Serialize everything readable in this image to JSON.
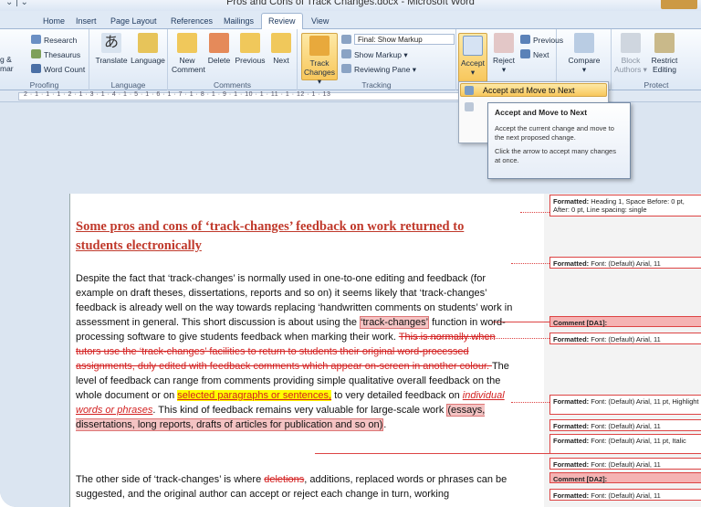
{
  "window": {
    "title": "Pros and Cons of Track Changes.docx - Microsoft Word"
  },
  "tabs": [
    "Home",
    "Insert",
    "Page Layout",
    "References",
    "Mailings",
    "Review",
    "View"
  ],
  "ribbon": {
    "proofing": {
      "label": "Proofing",
      "research": "Research",
      "thesaurus": "Thesaurus",
      "word_count": "Word Count",
      "spelling_top": "g &",
      "spelling_bottom": "mar"
    },
    "language": {
      "label": "Language",
      "translate": "Translate",
      "language": "Language"
    },
    "comments": {
      "label": "Comments",
      "new": "New",
      "new2": "Comment",
      "delete": "Delete",
      "previous": "Previous",
      "next": "Next"
    },
    "tracking": {
      "label": "Tracking",
      "track": "Track",
      "track2": "Changes ▾",
      "final_markup": "Final: Show Markup",
      "show_markup": "Show Markup ▾",
      "reviewing_pane": "Reviewing Pane ▾"
    },
    "changes": {
      "accept": "Accept",
      "reject": "Reject",
      "previous": "Previous",
      "next": "Next"
    },
    "compare": {
      "label": "Compare"
    },
    "protect": {
      "label": "Protect",
      "block": "Block",
      "block2": "Authors ▾",
      "restrict": "Restrict",
      "restrict2": "Editing"
    }
  },
  "ruler": {
    "text": "2 · 1 · 1 · 1 · 2 · 1 · 3 · 1 · 4 · 1 · 5 · 1 · 6 · 1 · 7 · 1 · 8 · 1 · 9 · 1 · 10 · 1 · 11 · 1 · 12 · 1 · 13"
  },
  "menu": {
    "item1": "Accept and Move to Next"
  },
  "tooltip": {
    "title": "Accept and Move to Next",
    "body": "Accept the current change and move to the next proposed change.",
    "body2": "Click the arrow to accept many changes at once."
  },
  "document": {
    "heading": "Some pros and cons of ‘track-changes’ feedback on work returned to students electronically",
    "p1_a": "Despite the fact that ‘track-changes’ is normally used in one-to-one editing and feedback (for example on draft theses, dissertations, reports and so on) it seems likely that ‘track-changes’ feedback is already well on the way towards replacing ‘handwritten comments on students’ work in assessment in general. This short discussion is about using the ",
    "p1_cmt": "‘track-changes’",
    "p1_b": " function in word-processing software to give students feedback when marking their work. ",
    "p1_del": "This is normally when tutors use the ‘track-changes’ facilities to return to students their original word-processed assignments, duly edited with feedback comments which appear on-screen in another colour. ",
    "p1_c": "The level of feedback can range from comments providing simple qualitative overall feedback on the whole document or on ",
    "p1_hl": "selected paragraphs or sentences,",
    "p1_d": " to very detailed feedback on ",
    "p1_it": "individual words or phrases",
    "p1_e": ". This kind of feedback remains very valuable for large-scale work ",
    "p1_cmt2": "(essays, dissertations, long reports, drafts of articles for publication and so on)",
    "p1_f": ".",
    "p2_a": "The other side of ‘track-changes’ is where ",
    "p2_del": "deletions",
    "p2_b": ", additions, replaced words or phrases can be suggested, and the original author can accept or reject each change in turn, working"
  },
  "balloons": {
    "b1": "Formatted: Heading 1, Space Before: 0 pt, After: 0 pt, Line spacing: single",
    "b2": "Formatted: Font: (Default) Arial, 11",
    "b3": "Comment [DA1]:",
    "b4": "Formatted: Font: (Default) Arial, 11",
    "b5": "Formatted: Font: (Default) Arial, 11 pt, Highlight",
    "b6": "Formatted: Font: (Default) Arial, 11",
    "b7": "Formatted: Font: (Default) Arial, 11 pt, Italic",
    "b8": "Formatted: Font: (Default) Arial, 11",
    "b9": "Comment [DA2]:",
    "b10": "Formatted: Font: (Default) Arial, 11"
  }
}
